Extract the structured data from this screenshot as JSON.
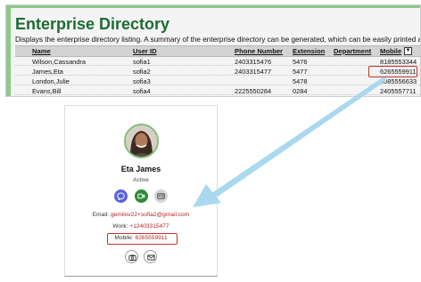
{
  "directory": {
    "title": "Enterprise Directory",
    "description": "Displays the enterprise directory listing. A summary of the enterprise directory can be generated, which can be easily printed and a detailed ph",
    "columns": {
      "name": "Name",
      "user_id": "User ID",
      "phone": "Phone Number",
      "extension": "Extension",
      "department": "Department",
      "mobile": "Mobile"
    },
    "rows": [
      {
        "name": "Wilson,Cassandra",
        "user_id": "sofia1",
        "phone": "2403315476",
        "extension": "5476",
        "department": "",
        "mobile": "8185553344"
      },
      {
        "name": "James,Eta",
        "user_id": "sofia2",
        "phone": "2403315477",
        "extension": "5477",
        "department": "",
        "mobile": "6265559911"
      },
      {
        "name": "London,Julie",
        "user_id": "sofia3",
        "phone": "",
        "extension": "5478",
        "department": "",
        "mobile": "4085556633"
      },
      {
        "name": "Evans,Bill",
        "user_id": "sofia4",
        "phone": "2225550284",
        "extension": "0284",
        "department": "",
        "mobile": "2405557711"
      }
    ]
  },
  "card": {
    "name": "Eta James",
    "status": "Active",
    "email_label": "Email:",
    "email_value": "gemilov22+sofia2@gmail.com",
    "work_label": "Work:",
    "work_value": "+12403315477",
    "mobile_label": "Mobile:",
    "mobile_value": "6265559911",
    "actions": [
      "chat-icon",
      "video-icon",
      "contact-card-icon"
    ],
    "footer_actions": [
      "camera-icon",
      "mail-icon"
    ]
  },
  "colors": {
    "title_green": "#1d6b33",
    "accent_green": "#8cc98a",
    "highlight_red": "#c2342c",
    "link_red": "#b3262a",
    "chat_blue": "#5a63d6",
    "video_green": "#2e8a3a",
    "arrow_blue": "#a9d8ef"
  }
}
